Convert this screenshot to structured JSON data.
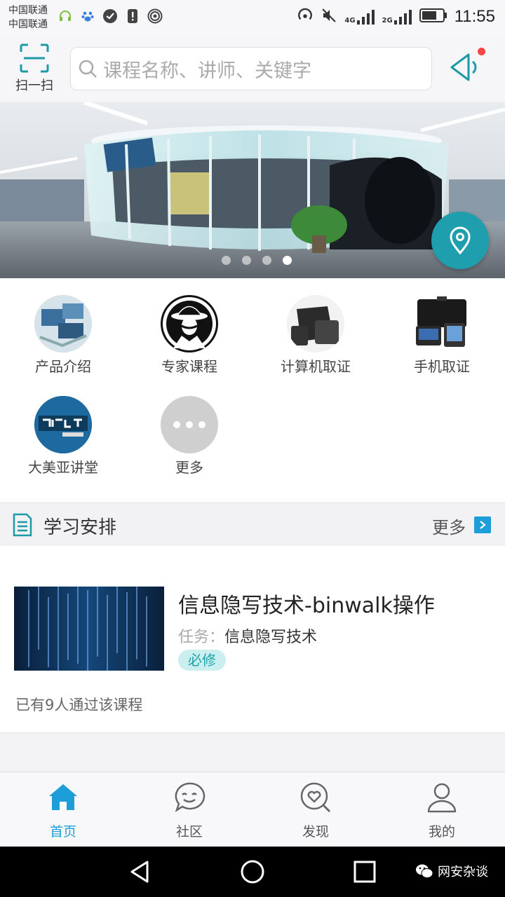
{
  "status_bar": {
    "carrier1": "中国联通",
    "carrier2": "中国联通",
    "net1": "4G",
    "net2": "2G",
    "time": "11:55"
  },
  "header": {
    "scan_label": "扫一扫",
    "search_placeholder": "课程名称、讲师、关键字"
  },
  "banner": {
    "slide_count": 4,
    "active_slide": 4
  },
  "quick_items": [
    {
      "label": "产品介绍",
      "icon": "product-intro-icon"
    },
    {
      "label": "专家课程",
      "icon": "expert-course-icon"
    },
    {
      "label": "计算机取证",
      "icon": "computer-forensics-icon"
    },
    {
      "label": "手机取证",
      "icon": "mobile-forensics-icon"
    },
    {
      "label": "大美亚讲堂",
      "icon": "lecture-hall-icon"
    },
    {
      "label": "更多",
      "icon": "more-icon"
    }
  ],
  "section": {
    "title": "学习安排",
    "more": "更多"
  },
  "course": {
    "title": "信息隐写技术-binwalk操作",
    "task_label": "任务：",
    "task_value": "信息隐写技术",
    "badge": "必修",
    "passed": "已有9人通过该课程"
  },
  "tabs": [
    {
      "label": "首页",
      "icon": "home-icon",
      "active": true
    },
    {
      "label": "社区",
      "icon": "community-icon",
      "active": false
    },
    {
      "label": "发现",
      "icon": "discover-icon",
      "active": false
    },
    {
      "label": "我的",
      "icon": "profile-icon",
      "active": false
    }
  ],
  "watermark": "网安杂谈",
  "colors": {
    "accent": "#1e9ed8",
    "teal": "#1f9fae",
    "badge_bg": "#cbeef0",
    "badge_text": "#1aa3a8",
    "notification": "#f1493f"
  }
}
